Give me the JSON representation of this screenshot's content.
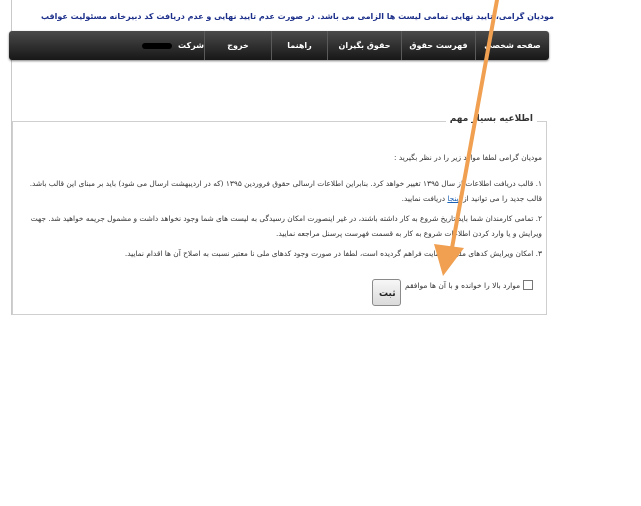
{
  "top_notice": "مودیان گرامی، تایید نهایی تمامی لیست ها الزامی می باشد. در صورت عدم تایید نهایی و عدم دریافت کد دبیرخانه مسئولیت عواقب بعدی به عهده مودی می باشد",
  "navbar": {
    "items": [
      {
        "label": "صفحه شخصی"
      },
      {
        "label": "فهرست حقوق"
      },
      {
        "label": "حقوق بگیران"
      },
      {
        "label": "راهنما"
      },
      {
        "label": "خروج"
      }
    ],
    "brand_label": "شرکت"
  },
  "notice": {
    "legend": "اطلاعیه بسیار مهم",
    "intro": "مودیان گرامی لطفا موارد زیر را در نظر بگیرید :",
    "item1": "۱. قالب دریافت اطلاعات از سال ۱۳۹۵ تغییر خواهد کرد. بنابراین اطلاعات ارسالی حقوق فروردین ۱۳۹۵ (که در اردیبهشت ارسال می شود) باید بر مبنای این قالب باشد. قالب جدید را می توانید از",
    "item1_link": "اینجا",
    "item1_suffix": "دریافت نمایید.",
    "item2": "۲. تمامی کارمندان شما باید تاریخ شروع به کار داشته باشند، در غیر اینصورت امکان رسیدگی به لیست های شما وجود نخواهد داشت و مشمول جریمه خواهید شد. جهت ویرایش و یا وارد کردن اطلاعات شروع به کار به قسمت فهرست پرسنل مراجعه نمایید.",
    "item3": "۳. امکان ویرایش کدهای ملی در سایت فراهم گردیده است، لطفا در صورت وجود کدهای ملی نا معتبر نسبت به اصلاح آن ها اقدام نمایید.",
    "agree_label": "موارد بالا را خوانده و با آن ها موافقم",
    "submit_label": "ثبت"
  },
  "colors": {
    "navbar_top": "#4a4a4a",
    "navbar_bottom": "#171717",
    "notice_text": "#1c2f8a",
    "arrow": "#f0a050"
  },
  "icons": {
    "arrow": "orange-annotation-arrow"
  }
}
